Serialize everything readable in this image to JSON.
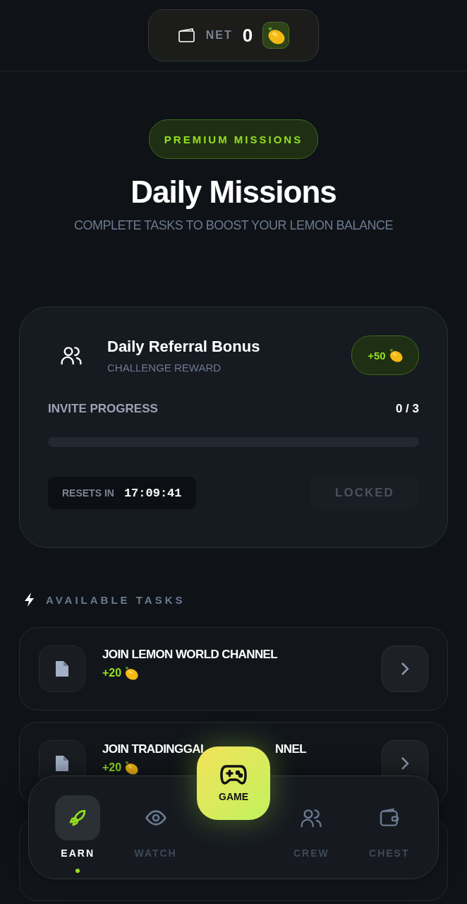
{
  "balance": {
    "label": "NET",
    "value": "0"
  },
  "badge": "PREMIUM MISSIONS",
  "title": "Daily Missions",
  "subtitle": "COMPLETE TASKS TO BOOST YOUR LEMON BALANCE",
  "referral": {
    "title": "Daily Referral Bonus",
    "subtitle": "CHALLENGE REWARD",
    "reward": "+50",
    "progress_label": "INVITE PROGRESS",
    "progress_count": "0 / 3",
    "level": 0,
    "reset_label": "RESETS IN",
    "reset_time": "17:09:41",
    "action": "LOCKED",
    "disabled": true
  },
  "section": "AVAILABLE TASKS",
  "tasks": [
    {
      "title_parts": [
        "JOIN LEMON WORLD CHANNEL"
      ],
      "reward": "+20"
    },
    {
      "title_parts": [
        "JOIN TRADINGGAI",
        "NNEL"
      ],
      "reward": "+20"
    }
  ],
  "nav": {
    "center": "GAME",
    "items": [
      {
        "label": "EARN",
        "kind": "rocket",
        "selected": true
      },
      {
        "label": "WATCH",
        "kind": "eye",
        "selected": false
      },
      {
        "label": "CREW",
        "kind": "users",
        "selected": false
      },
      {
        "label": "CHEST",
        "kind": "wallet",
        "selected": false
      }
    ]
  }
}
